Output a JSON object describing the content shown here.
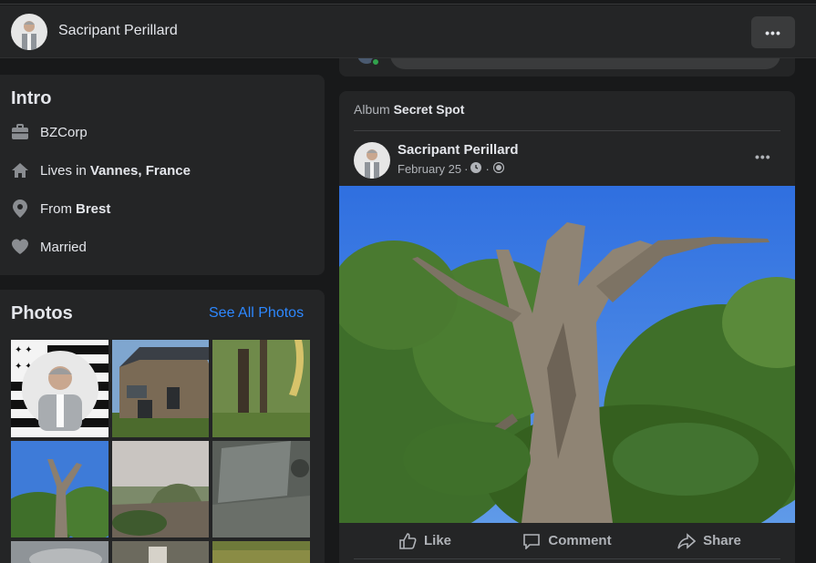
{
  "header": {
    "name": "Sacripant Perillard",
    "more": "•••"
  },
  "intro": {
    "title": "Intro",
    "work": "BZCorp",
    "lives_prefix": "Lives in",
    "lives_place": "Vannes, France",
    "from_prefix": "From",
    "from_place": "Brest",
    "relationship": "Married"
  },
  "photos": {
    "title": "Photos",
    "see_all": "See All Photos"
  },
  "post": {
    "album_prefix": "Album",
    "album_name": "Secret Spot",
    "author": "Sacripant Perillard",
    "date": "February 25",
    "dot": "·",
    "more": "•••",
    "actions": {
      "like": "Like",
      "comment": "Comment",
      "share": "Share"
    }
  },
  "colors": {
    "background": "#18191a",
    "card": "#242526",
    "link": "#2d88ff",
    "online": "#31a24c"
  }
}
